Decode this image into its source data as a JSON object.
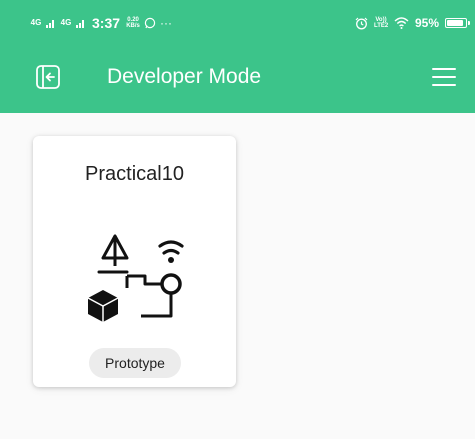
{
  "status_bar": {
    "network_1": "4G",
    "network_2": "4G",
    "time": "3:37",
    "speed_value": "0.20",
    "speed_unit": "KB/s",
    "more": "···",
    "volte_1": "Vo))",
    "volte_2": "LTE2",
    "battery_percent": "95%",
    "battery_level": 0.95,
    "icons": [
      "signal-icon",
      "whatsapp-icon",
      "alarm-icon",
      "wifi-icon",
      "battery-icon"
    ]
  },
  "app_bar": {
    "title": "Developer Mode",
    "background": "#3cc48a",
    "icons": [
      "exit-icon",
      "menu-icon"
    ]
  },
  "cards": [
    {
      "title": "Practical10",
      "icon": "prototype-icon",
      "badge": "Prototype"
    }
  ]
}
